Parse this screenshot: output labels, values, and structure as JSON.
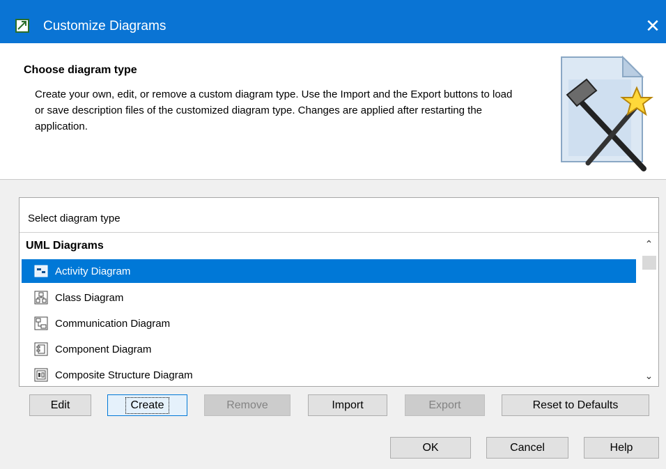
{
  "window": {
    "title": "Customize Diagrams",
    "close_glyph": "✕",
    "app_icon": "diagram-app-icon",
    "accent": "#0a74d4"
  },
  "header": {
    "title": "Choose diagram type",
    "description": "Create your own, edit, or remove a custom diagram type. Use the Import and the Export buttons to load or save description files of the customized diagram type. Changes are applied after restarting the application."
  },
  "list": {
    "label": "Select diagram type",
    "group": "UML Diagrams",
    "selected_color": "#0078d7",
    "items": [
      {
        "label": "Activity Diagram",
        "icon": "activity-diagram-icon"
      },
      {
        "label": "Class Diagram",
        "icon": "class-diagram-icon"
      },
      {
        "label": "Communication Diagram",
        "icon": "communication-diagram-icon"
      },
      {
        "label": "Component Diagram",
        "icon": "component-diagram-icon"
      },
      {
        "label": "Composite Structure Diagram",
        "icon": "composite-structure-diagram-icon"
      }
    ],
    "scroll_up": "⌃",
    "scroll_down": "⌄"
  },
  "actions": {
    "edit": "Edit",
    "create": "Create",
    "remove": "Remove",
    "import": "Import",
    "export": "Export",
    "reset": "Reset to Defaults"
  },
  "footer": {
    "ok": "OK",
    "cancel": "Cancel",
    "help": "Help"
  }
}
